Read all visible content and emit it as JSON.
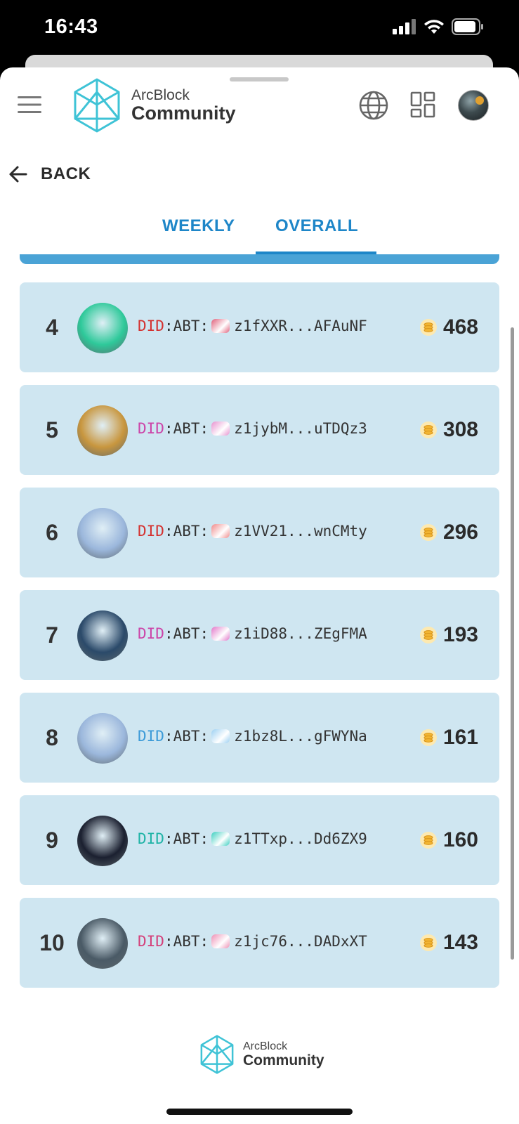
{
  "status_bar": {
    "time": "16:43"
  },
  "header": {
    "brand_top": "ArcBlock",
    "brand_bottom": "Community"
  },
  "nav": {
    "back_label": "BACK"
  },
  "tabs": [
    {
      "label": "WEEKLY",
      "active": false
    },
    {
      "label": "OVERALL",
      "active": true
    }
  ],
  "leaderboard": [
    {
      "rank": "4",
      "did_prefix": "DID",
      "did_sep": ":ABT:",
      "did_short": "z1fXXR...AFAuNF",
      "score": "468",
      "prefix_color": "#d4312f",
      "badge_color": "#e0607a",
      "avatar_bg": "#2ec99a"
    },
    {
      "rank": "5",
      "did_prefix": "DID",
      "did_sep": ":ABT:",
      "did_short": "z1jybM...uTDQz3",
      "score": "308",
      "prefix_color": "#cc44a8",
      "badge_color": "#e792cf",
      "avatar_bg": "#c8963e"
    },
    {
      "rank": "6",
      "did_prefix": "DID",
      "did_sep": ":ABT:",
      "did_short": "z1VV21...wnCMty",
      "score": "296",
      "prefix_color": "#d4312f",
      "badge_color": "#f08a8a",
      "avatar_bg": "#9bb7dc"
    },
    {
      "rank": "7",
      "did_prefix": "DID",
      "did_sep": ":ABT:",
      "did_short": "z1iD88...ZEgFMA",
      "score": "193",
      "prefix_color": "#cc44a8",
      "badge_color": "#e277c9",
      "avatar_bg": "#2b4a6a"
    },
    {
      "rank": "8",
      "did_prefix": "DID",
      "did_sep": ":ABT:",
      "did_short": "z1bz8L...gFWYNa",
      "score": "161",
      "prefix_color": "#3b9ad8",
      "badge_color": "#9cd0f2",
      "avatar_bg": "#9bb7dc"
    },
    {
      "rank": "9",
      "did_prefix": "DID",
      "did_sep": ":ABT:",
      "did_short": "z1TTxp...Dd6ZX9",
      "score": "160",
      "prefix_color": "#1fb3a6",
      "badge_color": "#3ccfc0",
      "avatar_bg": "#1b2030"
    },
    {
      "rank": "10",
      "did_prefix": "DID",
      "did_sep": ":ABT:",
      "did_short": "z1jc76...DADxXT",
      "score": "143",
      "prefix_color": "#d4407a",
      "badge_color": "#ee8fb4",
      "avatar_bg": "#4a5a66"
    }
  ],
  "footer": {
    "brand_top": "ArcBlock",
    "brand_bottom": "Community"
  },
  "colors": {
    "accent": "#1e86c8",
    "row_bg": "#cfe6f1",
    "logo": "#3fc3d6"
  }
}
